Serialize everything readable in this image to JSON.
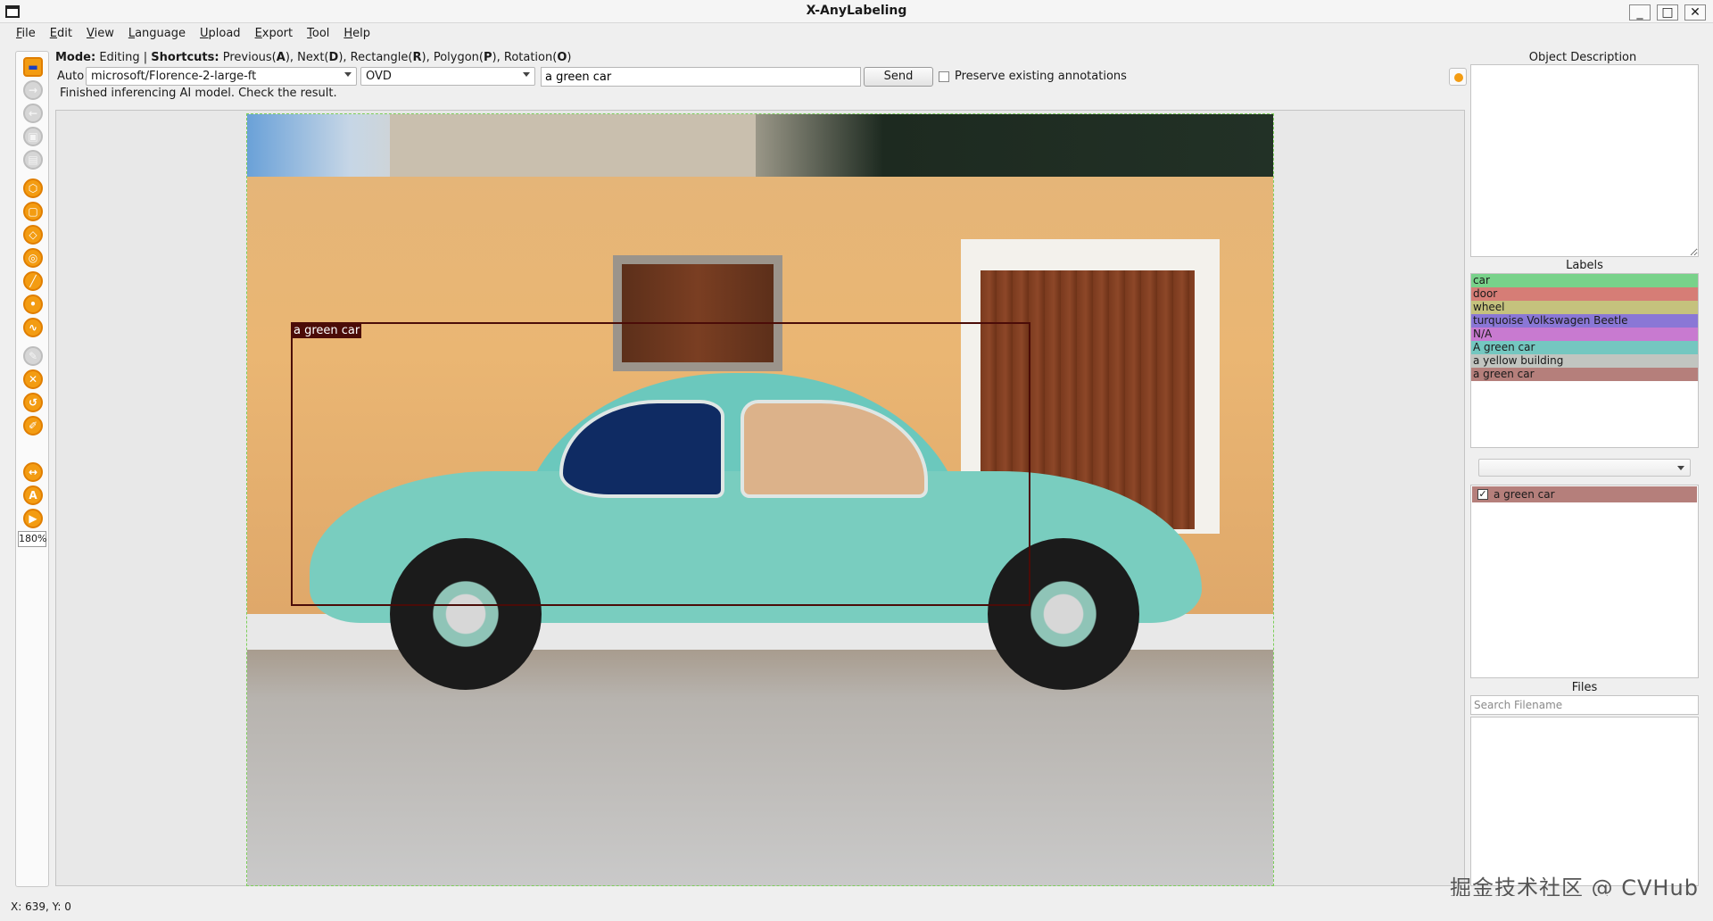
{
  "window": {
    "title": "X-AnyLabeling",
    "minimize": "_",
    "maximize": "□",
    "close": "✕"
  },
  "menubar": {
    "items": [
      {
        "label": "File"
      },
      {
        "label": "Edit"
      },
      {
        "label": "View"
      },
      {
        "label": "Language"
      },
      {
        "label": "Upload"
      },
      {
        "label": "Export"
      },
      {
        "label": "Tool"
      },
      {
        "label": "Help"
      }
    ]
  },
  "mode_bar": {
    "mode_label": "Mode:",
    "mode_value": "Editing",
    "separator": "|",
    "shortcuts_label": "Shortcuts:",
    "shortcut_text_1": "Previous(",
    "key_1": "A",
    "shortcut_text_2": "), Next(",
    "key_2": "D",
    "shortcut_text_3": "), Rectangle(",
    "key_3": "R",
    "shortcut_text_4": "), Polygon(",
    "key_4": "P",
    "shortcut_text_5": "), Rotation(",
    "key_5": "O",
    "shortcut_text_6": ")"
  },
  "auto_panel": {
    "label": "Auto",
    "model_selected": "microsoft/Florence-2-large-ft",
    "task_selected": "OVD",
    "prompt_value": "a green car",
    "send_label": "Send",
    "preserve_label": "Preserve existing annotations",
    "preserve_checked": false,
    "status_message": "Finished inferencing AI model. Check the result."
  },
  "toolbar": {
    "zoom": "180%",
    "tools": [
      {
        "icon": "open-folder-icon",
        "glyph": "▬",
        "style": "orange-blue"
      },
      {
        "icon": "next-image-icon",
        "glyph": "→",
        "style": "gray"
      },
      {
        "icon": "prev-image-icon",
        "glyph": "←",
        "style": "gray"
      },
      {
        "icon": "save-icon",
        "glyph": "▣",
        "style": "gray"
      },
      {
        "icon": "delete-file-icon",
        "glyph": "▤",
        "style": "gray"
      },
      {
        "icon": "polygon-icon",
        "glyph": "⬡",
        "style": "orange"
      },
      {
        "icon": "rectangle-icon",
        "glyph": "▢",
        "style": "orange"
      },
      {
        "icon": "rotation-icon",
        "glyph": "◇",
        "style": "orange"
      },
      {
        "icon": "circle-icon",
        "glyph": "◎",
        "style": "orange"
      },
      {
        "icon": "line-icon",
        "glyph": "╱",
        "style": "orange"
      },
      {
        "icon": "point-icon",
        "glyph": "•",
        "style": "orange"
      },
      {
        "icon": "linestrip-icon",
        "glyph": "∿",
        "style": "orange"
      },
      {
        "icon": "edit-icon",
        "glyph": "✎",
        "style": "gray"
      },
      {
        "icon": "delete-icon",
        "glyph": "✕",
        "style": "orange"
      },
      {
        "icon": "undo-icon",
        "glyph": "↺",
        "style": "orange"
      },
      {
        "icon": "brush-icon",
        "glyph": "✐",
        "style": "orange"
      },
      {
        "icon": "fit-width-icon",
        "glyph": "↔",
        "style": "orange"
      },
      {
        "icon": "ai-icon",
        "glyph": "A",
        "style": "orange"
      },
      {
        "icon": "run-icon",
        "glyph": "▶",
        "style": "orange"
      }
    ]
  },
  "canvas": {
    "annotation_label": "a green car",
    "annotation_color": "#4b0c08"
  },
  "right_panel": {
    "description_title": "Object Description",
    "labels_title": "Labels",
    "labels": [
      {
        "name": "car",
        "color": "#78d28a"
      },
      {
        "name": "door",
        "color": "#d67d76"
      },
      {
        "name": "wheel",
        "color": "#c5c27d"
      },
      {
        "name": "turquoise Volkswagen Beetle",
        "color": "#8a77d6"
      },
      {
        "name": "N/A",
        "color": "#c87ad0"
      },
      {
        "name": "A green car",
        "color": "#74c7c0"
      },
      {
        "name": "a yellow building",
        "color": "#c1c5c0"
      },
      {
        "name": "a green car",
        "color": "#b57f7b"
      }
    ],
    "instance_label": "a green car",
    "instance_checked": true,
    "files_title": "Files",
    "files_search_placeholder": "Search Filename"
  },
  "status_bar": {
    "coords": "X: 639, Y: 0"
  },
  "watermark": "掘金技术社区 @ CVHub"
}
